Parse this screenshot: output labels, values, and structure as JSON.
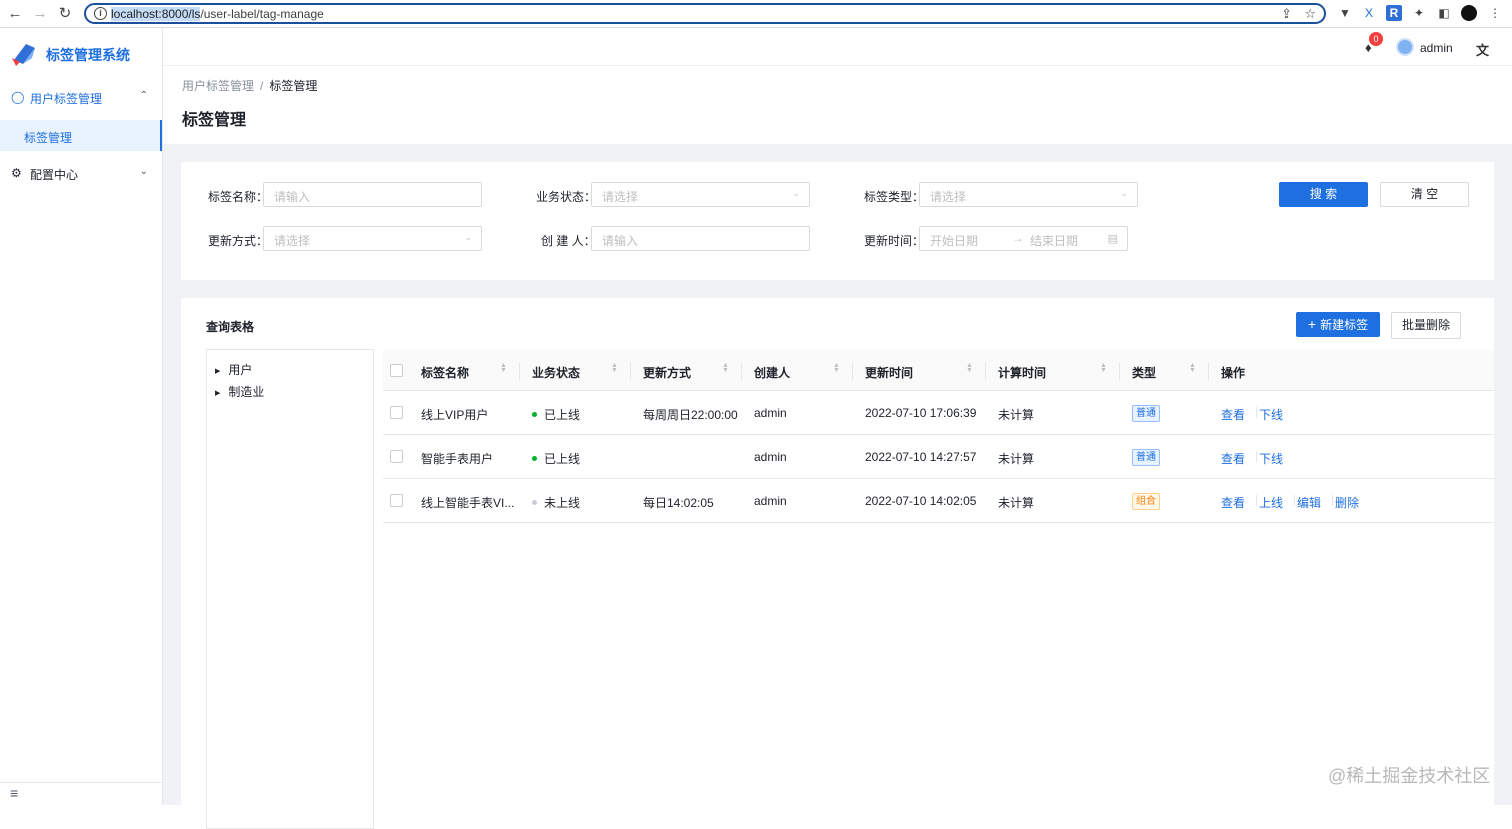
{
  "browser": {
    "url_highlight": "localhost:8000/ls",
    "url_rest": "/user-label/tag-manage"
  },
  "sidebar": {
    "app_title": "标签管理系统",
    "groups": [
      {
        "label": "用户标签管理",
        "expanded": true
      },
      {
        "label": "配置中心",
        "expanded": false
      }
    ],
    "active_item": "标签管理"
  },
  "header": {
    "notification_count": "0",
    "username": "admin"
  },
  "page": {
    "breadcrumb": [
      "用户标签管理",
      "标签管理"
    ],
    "title": "标签管理"
  },
  "filters": {
    "tag_name": {
      "label": "标签名称：",
      "placeholder": "请输入"
    },
    "biz_status": {
      "label": "业务状态：",
      "placeholder": "请选择"
    },
    "tag_type": {
      "label": "标签类型：",
      "placeholder": "请选择"
    },
    "update_mode": {
      "label": "更新方式：",
      "placeholder": "请选择"
    },
    "creator": {
      "label": "创 建 人：",
      "placeholder": "请输入"
    },
    "update_time": {
      "label": "更新时间：",
      "start_placeholder": "开始日期",
      "end_placeholder": "结束日期"
    },
    "search_label": "搜 索",
    "clear_label": "清 空"
  },
  "table_card": {
    "title": "查询表格",
    "new_label": "新建标签",
    "batch_delete_label": "批量删除"
  },
  "tree": [
    "用户",
    "制造业"
  ],
  "table": {
    "columns": [
      "标签名称",
      "业务状态",
      "更新方式",
      "创建人",
      "更新时间",
      "计算时间",
      "类型",
      "操作"
    ],
    "rows": [
      {
        "name": "线上VIP用户",
        "status": "已上线",
        "status_color": "#00b42a",
        "mode": "每周周日22:00:00",
        "creator": "admin",
        "updated": "2022-07-10 17:06:39",
        "calc": "未计算",
        "type": "普通",
        "type_color": "blue",
        "ops": [
          "查看",
          "下线"
        ]
      },
      {
        "name": "智能手表用户",
        "status": "已上线",
        "status_color": "#00b42a",
        "mode": "",
        "creator": "admin",
        "updated": "2022-07-10 14:27:57",
        "calc": "未计算",
        "type": "普通",
        "type_color": "blue",
        "ops": [
          "查看",
          "下线"
        ]
      },
      {
        "name": "线上智能手表VI...",
        "status": "未上线",
        "status_color": "#c9cdd4",
        "mode": "每日14:02:05",
        "creator": "admin",
        "updated": "2022-07-10 14:02:05",
        "calc": "未计算",
        "type": "组合",
        "type_color": "orange",
        "ops": [
          "查看",
          "上线",
          "编辑",
          "删除"
        ]
      }
    ]
  },
  "watermark": "@稀土掘金技术社区"
}
